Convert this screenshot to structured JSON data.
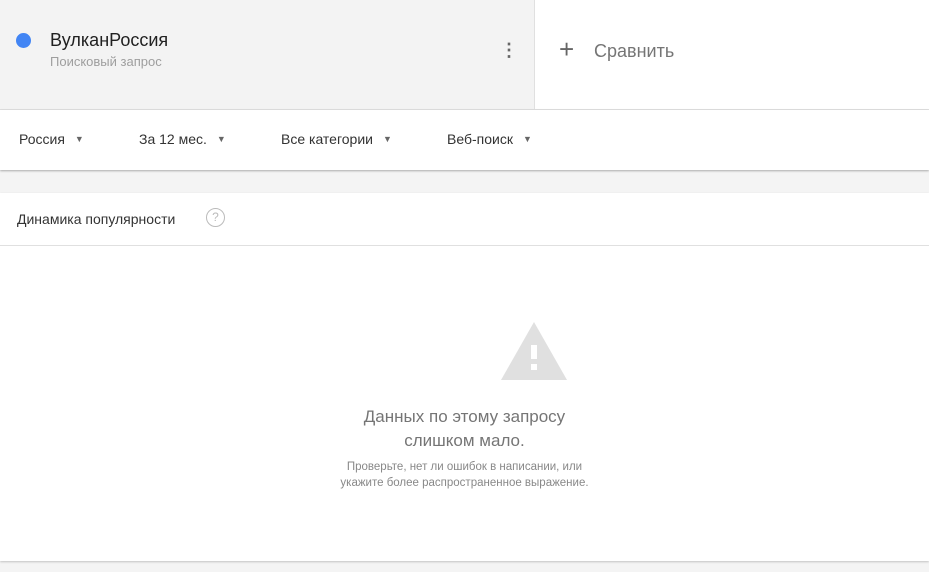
{
  "term": {
    "name": "ВулканРоссия",
    "type": "Поисковый запрос",
    "color": "#4285f4"
  },
  "compare": {
    "icon": "+",
    "label": "Сравнить"
  },
  "filters": [
    {
      "label": "Россия"
    },
    {
      "label": "За 12 мес."
    },
    {
      "label": "Все категории"
    },
    {
      "label": "Веб-поиск"
    }
  ],
  "card": {
    "title": "Динамика популярности",
    "help": "?",
    "message_line1": "Данных по этому запросу",
    "message_line2": "слишком мало.",
    "hint_line1": "Проверьте, нет ли ошибок в написании, или",
    "hint_line2": "укажите более распространенное выражение."
  }
}
